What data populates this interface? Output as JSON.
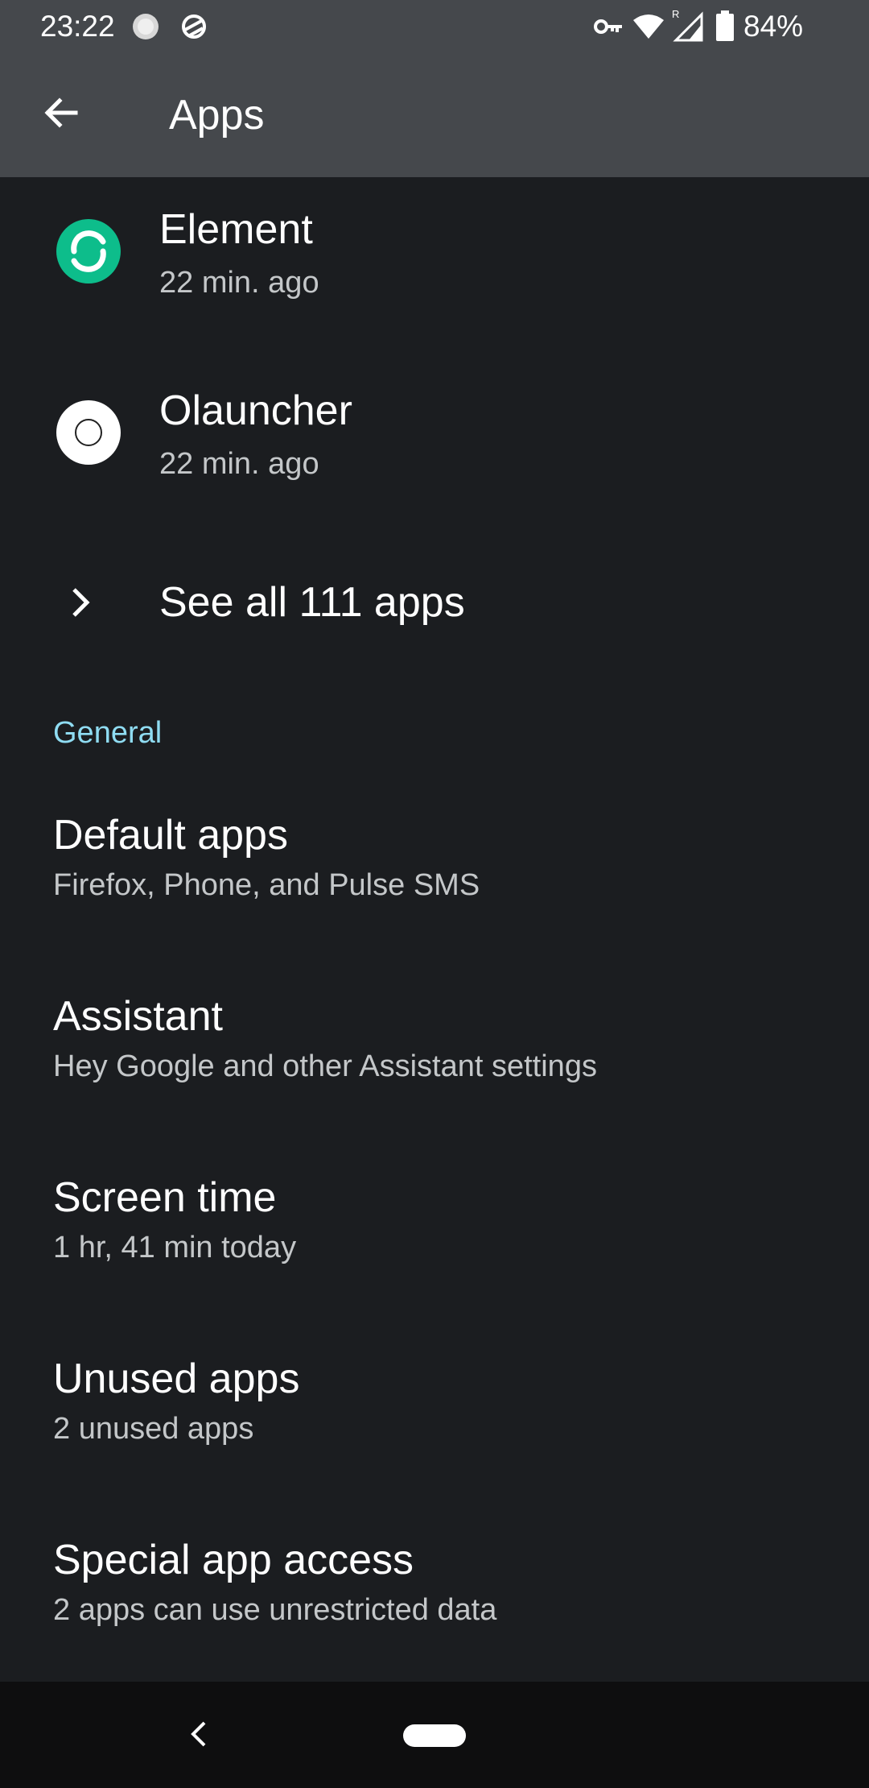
{
  "status_bar": {
    "time": "23:22",
    "battery_percent": "84%",
    "icons": [
      "notification-dot-icon",
      "sync-icon",
      "vpn-key-icon",
      "wifi-icon",
      "signal-roaming-icon",
      "battery-icon"
    ]
  },
  "app_bar": {
    "title": "Apps",
    "back_icon": "arrow-back-icon"
  },
  "recent_apps": [
    {
      "name": "Element",
      "time": "22 min. ago",
      "icon": "element-app-icon",
      "icon_color": "#0dbd8b"
    },
    {
      "name": "Olauncher",
      "time": "22 min. ago",
      "icon": "olauncher-app-icon",
      "icon_color": "#ffffff"
    }
  ],
  "see_all": {
    "label": "See all 111 apps",
    "icon": "chevron-right-icon"
  },
  "general": {
    "header": "General",
    "items": [
      {
        "title": "Default apps",
        "subtitle": "Firefox, Phone, and Pulse SMS"
      },
      {
        "title": "Assistant",
        "subtitle": "Hey Google and other Assistant settings"
      },
      {
        "title": "Screen time",
        "subtitle": "1 hr, 41 min today"
      },
      {
        "title": "Unused apps",
        "subtitle": "2 unused apps"
      },
      {
        "title": "Special app access",
        "subtitle": "2 apps can use unrestricted data"
      }
    ]
  },
  "nav_bar": {
    "back_icon": "nav-back-icon",
    "home_icon": "home-pill-icon"
  },
  "colors": {
    "app_bar_bg": "#45484c",
    "content_bg": "#1b1d20",
    "accent": "#8fdcf2",
    "subtitle": "#c4c7c9"
  }
}
